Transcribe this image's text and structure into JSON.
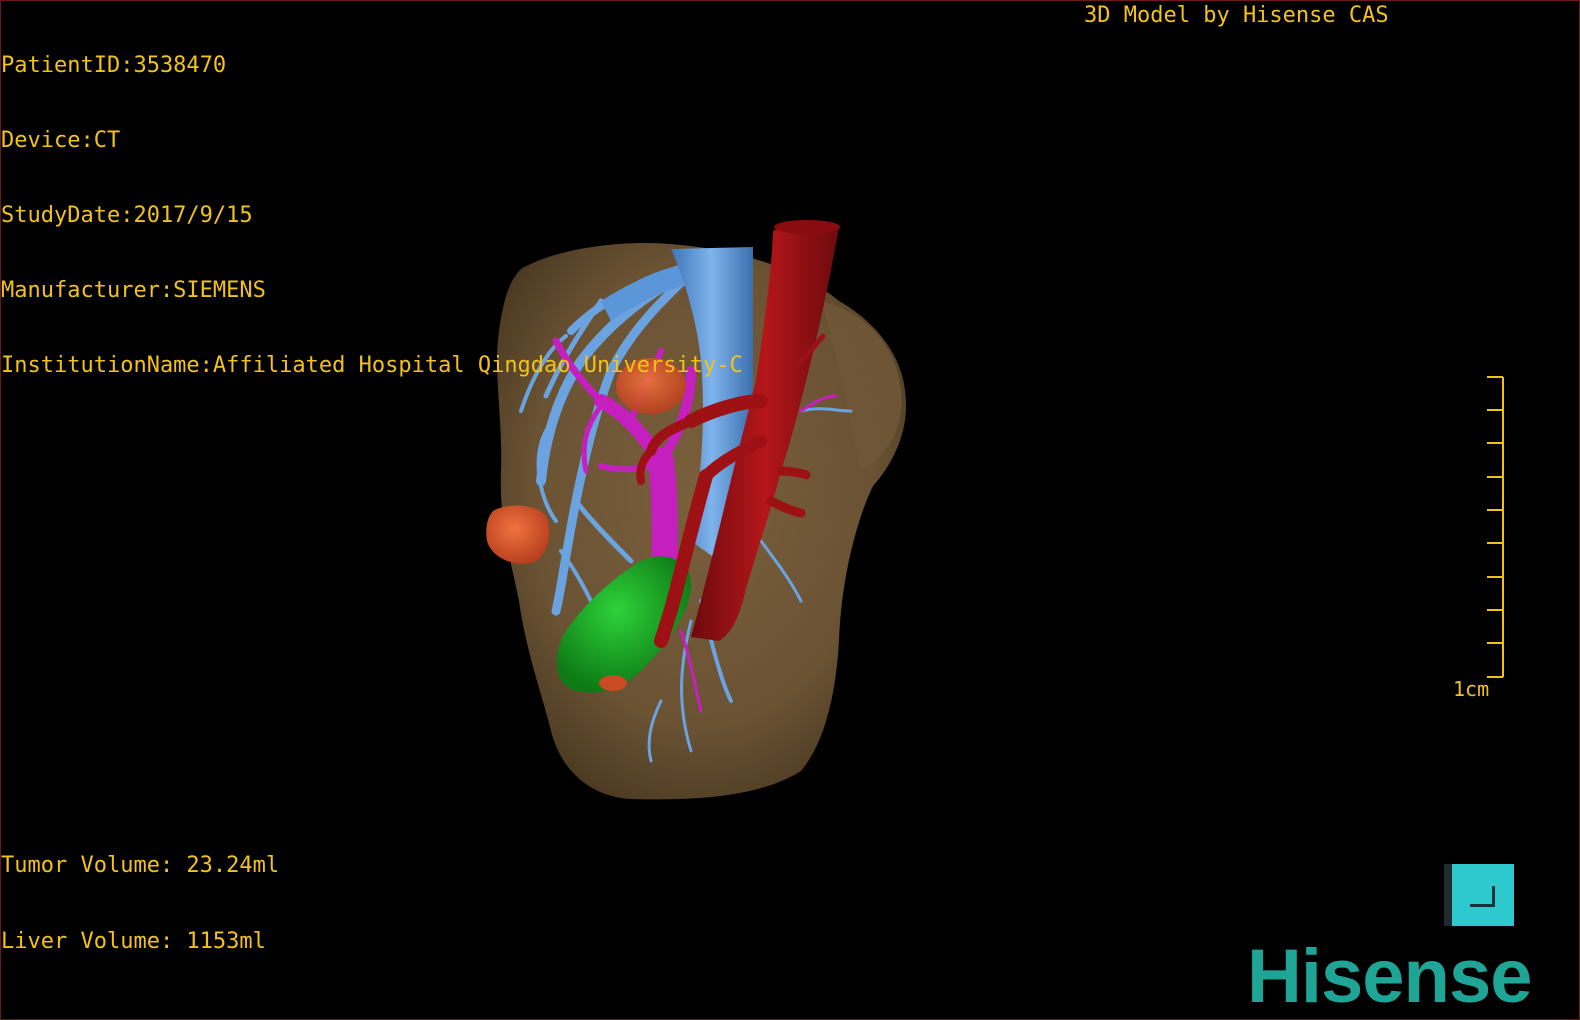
{
  "overlay": {
    "patient_id": "PatientID:3538470",
    "device": "Device:CT",
    "study_date": "StudyDate:2017/9/15",
    "manufacturer": "Manufacturer:SIEMENS",
    "institution": "InstitutionName:Affiliated Hospital Qingdao University-C",
    "model_credit": "3D Model by Hisense CAS",
    "tumor_volume": "Tumor Volume: 23.24ml",
    "liver_volume": "Liver Volume: 1153ml",
    "scale_label": "1cm"
  },
  "brand": {
    "logo_text": "Hisense",
    "color": "#1fa596"
  },
  "colors": {
    "overlay_text": "#f2c21b",
    "liver": "#6e5636",
    "hepatic_vein": "#5b97d8",
    "portal_vein": "#c61fbf",
    "artery_ivc": "#9d1013",
    "tumor": "#e0562e",
    "gallbladder": "#16a21f",
    "orientation_button": "#2ec9cf"
  },
  "icons": {
    "orientation_button": "corner-axis-icon"
  }
}
